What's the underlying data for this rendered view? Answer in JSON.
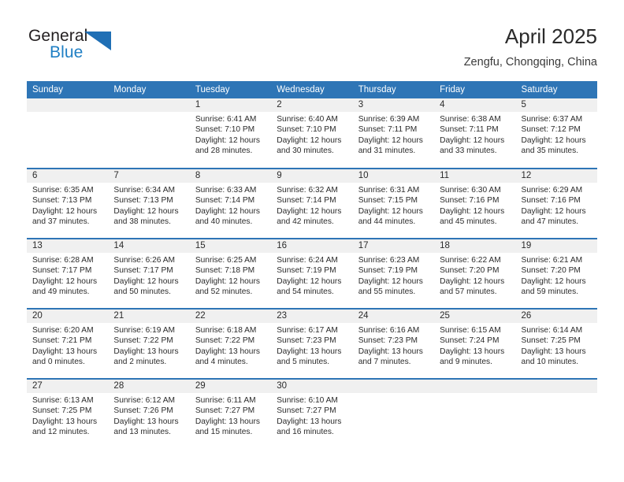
{
  "brand": {
    "word1": "General",
    "word2": "Blue",
    "logo_icon": "triangle-logo-icon",
    "color_primary": "#1f7fc4",
    "color_text": "#231f20"
  },
  "header": {
    "title": "April 2025",
    "subtitle": "Zengfu, Chongqing, China"
  },
  "theme": {
    "accent": "#2e75b6",
    "daynum_strip": "#f0f0f0",
    "text": "#2b2b2b"
  },
  "weekday_headers": [
    "Sunday",
    "Monday",
    "Tuesday",
    "Wednesday",
    "Thursday",
    "Friday",
    "Saturday"
  ],
  "weeks": [
    [
      {
        "empty": true
      },
      {
        "empty": true
      },
      {
        "day": "1",
        "sunrise": "Sunrise: 6:41 AM",
        "sunset": "Sunset: 7:10 PM",
        "daylight_line1": "Daylight: 12 hours",
        "daylight_line2": "and 28 minutes."
      },
      {
        "day": "2",
        "sunrise": "Sunrise: 6:40 AM",
        "sunset": "Sunset: 7:10 PM",
        "daylight_line1": "Daylight: 12 hours",
        "daylight_line2": "and 30 minutes."
      },
      {
        "day": "3",
        "sunrise": "Sunrise: 6:39 AM",
        "sunset": "Sunset: 7:11 PM",
        "daylight_line1": "Daylight: 12 hours",
        "daylight_line2": "and 31 minutes."
      },
      {
        "day": "4",
        "sunrise": "Sunrise: 6:38 AM",
        "sunset": "Sunset: 7:11 PM",
        "daylight_line1": "Daylight: 12 hours",
        "daylight_line2": "and 33 minutes."
      },
      {
        "day": "5",
        "sunrise": "Sunrise: 6:37 AM",
        "sunset": "Sunset: 7:12 PM",
        "daylight_line1": "Daylight: 12 hours",
        "daylight_line2": "and 35 minutes."
      }
    ],
    [
      {
        "day": "6",
        "sunrise": "Sunrise: 6:35 AM",
        "sunset": "Sunset: 7:13 PM",
        "daylight_line1": "Daylight: 12 hours",
        "daylight_line2": "and 37 minutes."
      },
      {
        "day": "7",
        "sunrise": "Sunrise: 6:34 AM",
        "sunset": "Sunset: 7:13 PM",
        "daylight_line1": "Daylight: 12 hours",
        "daylight_line2": "and 38 minutes."
      },
      {
        "day": "8",
        "sunrise": "Sunrise: 6:33 AM",
        "sunset": "Sunset: 7:14 PM",
        "daylight_line1": "Daylight: 12 hours",
        "daylight_line2": "and 40 minutes."
      },
      {
        "day": "9",
        "sunrise": "Sunrise: 6:32 AM",
        "sunset": "Sunset: 7:14 PM",
        "daylight_line1": "Daylight: 12 hours",
        "daylight_line2": "and 42 minutes."
      },
      {
        "day": "10",
        "sunrise": "Sunrise: 6:31 AM",
        "sunset": "Sunset: 7:15 PM",
        "daylight_line1": "Daylight: 12 hours",
        "daylight_line2": "and 44 minutes."
      },
      {
        "day": "11",
        "sunrise": "Sunrise: 6:30 AM",
        "sunset": "Sunset: 7:16 PM",
        "daylight_line1": "Daylight: 12 hours",
        "daylight_line2": "and 45 minutes."
      },
      {
        "day": "12",
        "sunrise": "Sunrise: 6:29 AM",
        "sunset": "Sunset: 7:16 PM",
        "daylight_line1": "Daylight: 12 hours",
        "daylight_line2": "and 47 minutes."
      }
    ],
    [
      {
        "day": "13",
        "sunrise": "Sunrise: 6:28 AM",
        "sunset": "Sunset: 7:17 PM",
        "daylight_line1": "Daylight: 12 hours",
        "daylight_line2": "and 49 minutes."
      },
      {
        "day": "14",
        "sunrise": "Sunrise: 6:26 AM",
        "sunset": "Sunset: 7:17 PM",
        "daylight_line1": "Daylight: 12 hours",
        "daylight_line2": "and 50 minutes."
      },
      {
        "day": "15",
        "sunrise": "Sunrise: 6:25 AM",
        "sunset": "Sunset: 7:18 PM",
        "daylight_line1": "Daylight: 12 hours",
        "daylight_line2": "and 52 minutes."
      },
      {
        "day": "16",
        "sunrise": "Sunrise: 6:24 AM",
        "sunset": "Sunset: 7:19 PM",
        "daylight_line1": "Daylight: 12 hours",
        "daylight_line2": "and 54 minutes."
      },
      {
        "day": "17",
        "sunrise": "Sunrise: 6:23 AM",
        "sunset": "Sunset: 7:19 PM",
        "daylight_line1": "Daylight: 12 hours",
        "daylight_line2": "and 55 minutes."
      },
      {
        "day": "18",
        "sunrise": "Sunrise: 6:22 AM",
        "sunset": "Sunset: 7:20 PM",
        "daylight_line1": "Daylight: 12 hours",
        "daylight_line2": "and 57 minutes."
      },
      {
        "day": "19",
        "sunrise": "Sunrise: 6:21 AM",
        "sunset": "Sunset: 7:20 PM",
        "daylight_line1": "Daylight: 12 hours",
        "daylight_line2": "and 59 minutes."
      }
    ],
    [
      {
        "day": "20",
        "sunrise": "Sunrise: 6:20 AM",
        "sunset": "Sunset: 7:21 PM",
        "daylight_line1": "Daylight: 13 hours",
        "daylight_line2": "and 0 minutes."
      },
      {
        "day": "21",
        "sunrise": "Sunrise: 6:19 AM",
        "sunset": "Sunset: 7:22 PM",
        "daylight_line1": "Daylight: 13 hours",
        "daylight_line2": "and 2 minutes."
      },
      {
        "day": "22",
        "sunrise": "Sunrise: 6:18 AM",
        "sunset": "Sunset: 7:22 PM",
        "daylight_line1": "Daylight: 13 hours",
        "daylight_line2": "and 4 minutes."
      },
      {
        "day": "23",
        "sunrise": "Sunrise: 6:17 AM",
        "sunset": "Sunset: 7:23 PM",
        "daylight_line1": "Daylight: 13 hours",
        "daylight_line2": "and 5 minutes."
      },
      {
        "day": "24",
        "sunrise": "Sunrise: 6:16 AM",
        "sunset": "Sunset: 7:23 PM",
        "daylight_line1": "Daylight: 13 hours",
        "daylight_line2": "and 7 minutes."
      },
      {
        "day": "25",
        "sunrise": "Sunrise: 6:15 AM",
        "sunset": "Sunset: 7:24 PM",
        "daylight_line1": "Daylight: 13 hours",
        "daylight_line2": "and 9 minutes."
      },
      {
        "day": "26",
        "sunrise": "Sunrise: 6:14 AM",
        "sunset": "Sunset: 7:25 PM",
        "daylight_line1": "Daylight: 13 hours",
        "daylight_line2": "and 10 minutes."
      }
    ],
    [
      {
        "day": "27",
        "sunrise": "Sunrise: 6:13 AM",
        "sunset": "Sunset: 7:25 PM",
        "daylight_line1": "Daylight: 13 hours",
        "daylight_line2": "and 12 minutes."
      },
      {
        "day": "28",
        "sunrise": "Sunrise: 6:12 AM",
        "sunset": "Sunset: 7:26 PM",
        "daylight_line1": "Daylight: 13 hours",
        "daylight_line2": "and 13 minutes."
      },
      {
        "day": "29",
        "sunrise": "Sunrise: 6:11 AM",
        "sunset": "Sunset: 7:27 PM",
        "daylight_line1": "Daylight: 13 hours",
        "daylight_line2": "and 15 minutes."
      },
      {
        "day": "30",
        "sunrise": "Sunrise: 6:10 AM",
        "sunset": "Sunset: 7:27 PM",
        "daylight_line1": "Daylight: 13 hours",
        "daylight_line2": "and 16 minutes."
      },
      {
        "empty": true
      },
      {
        "empty": true
      },
      {
        "empty": true
      }
    ]
  ]
}
